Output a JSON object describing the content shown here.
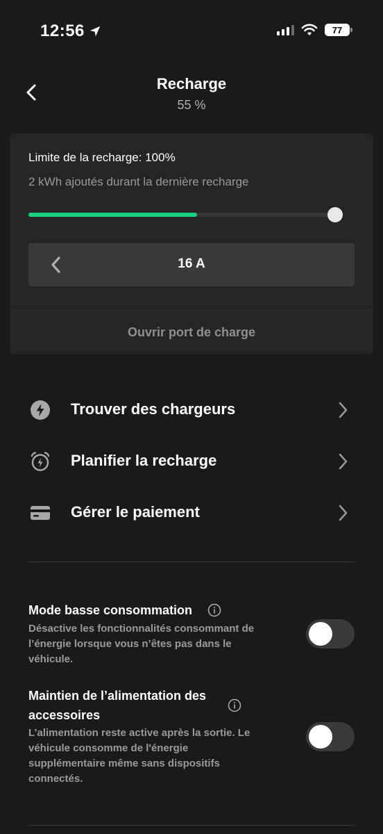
{
  "status_bar": {
    "time": "12:56",
    "battery": "77"
  },
  "header": {
    "title": "Recharge",
    "subtitle": "55 %"
  },
  "charge": {
    "limit_text": "Limite de la recharge: 100%",
    "added_text": "2 kWh ajoutés durant la dernière recharge",
    "current_level": 0.55,
    "limit_level": 1.0,
    "amperage": "16 A",
    "open_port": "Ouvrir port de charge"
  },
  "menu": {
    "items": [
      {
        "label": "Trouver des chargeurs",
        "icon": "bolt-icon"
      },
      {
        "label": "Planifier la recharge",
        "icon": "alarm-clock-icon"
      },
      {
        "label": "Gérer le paiement",
        "icon": "credit-card-icon"
      }
    ]
  },
  "settings": {
    "low_power": {
      "title": "Mode basse consommation",
      "desc_lines": [
        "Désactive les fonctionnalités consommant de",
        "l’énergie lorsque vous n’êtes pas dans le",
        "véhicule."
      ],
      "on": false
    },
    "accessory_power": {
      "title_lines": [
        "Maintien de l’alimentation des",
        "accessoires"
      ],
      "desc_lines": [
        "L’alimentation reste active après la sortie. Le",
        "véhicule consomme de l'énergie",
        "supplémentaire même sans dispositifs",
        "connectés."
      ],
      "on": false
    }
  },
  "colors": {
    "accent": "#19d27f",
    "background": "#1a1a1c",
    "card": "#252527"
  }
}
